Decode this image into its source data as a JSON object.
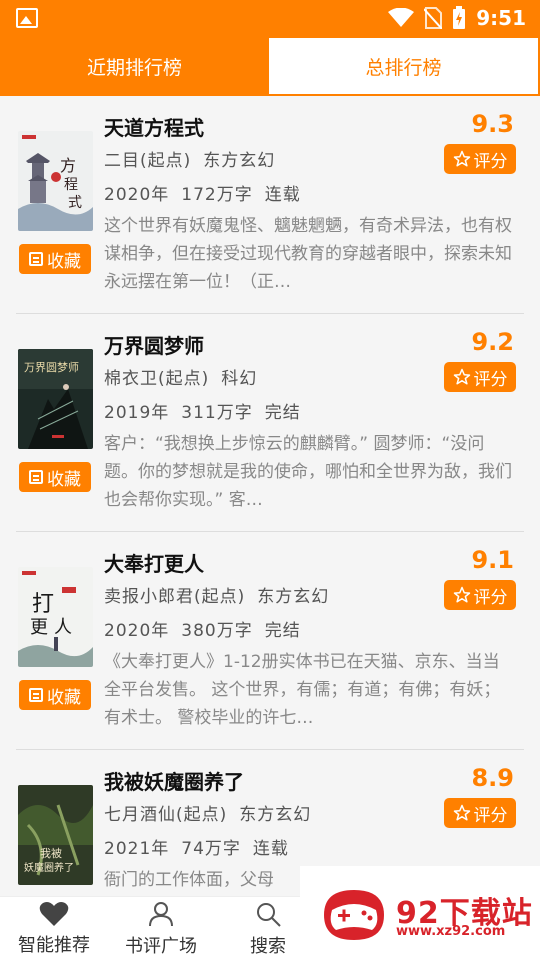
{
  "status": {
    "time": "9:51"
  },
  "tabs": [
    {
      "label": "近期排行榜",
      "active": true
    },
    {
      "label": "总排行榜",
      "active": false
    }
  ],
  "books": [
    {
      "title": "天道方程式",
      "score": "9.3",
      "rate_label": "评分",
      "fav_label": "收藏",
      "author": "二目(起点)",
      "genre": "东方玄幻",
      "year": "2020年",
      "words": "172万字",
      "state": "连载",
      "desc": "这个世界有妖魔鬼怪、魑魅魍魉，有奇术异法，也有权谋相争，但在接受过现代教育的穿越者眼中，探索未知永远摆在第一位！（正…"
    },
    {
      "title": "万界圆梦师",
      "score": "9.2",
      "rate_label": "评分",
      "fav_label": "收藏",
      "author": "棉衣卫(起点)",
      "genre": "科幻",
      "year": "2019年",
      "words": "311万字",
      "state": "完结",
      "desc": "客户：“我想换上步惊云的麒麟臂。” 圆梦师：“没问题。你的梦想就是我的使命，哪怕和全世界为敌，我们也会帮你实现。” 客…"
    },
    {
      "title": "大奉打更人",
      "score": "9.1",
      "rate_label": "评分",
      "fav_label": "收藏",
      "author": "卖报小郎君(起点)",
      "genre": "东方玄幻",
      "year": "2020年",
      "words": "380万字",
      "state": "完结",
      "desc": "《大奉打更人》1-12册实体书已在天猫、京东、当当全平台发售。 这个世界，有儒；有道；有佛；有妖；有术士。 警校毕业的许七…"
    },
    {
      "title": "我被妖魔圈养了",
      "score": "8.9",
      "rate_label": "评分",
      "fav_label": "收藏",
      "author": "七月酒仙(起点)",
      "genre": "东方玄幻",
      "year": "2021年",
      "words": "74万字",
      "state": "连载",
      "desc": "衙门的工作体面，父母"
    }
  ],
  "bottom_nav": [
    {
      "label": "智能推荐",
      "icon": "heart-icon"
    },
    {
      "label": "书评广场",
      "icon": "user-icon"
    },
    {
      "label": "搜索",
      "icon": "search-icon"
    }
  ],
  "watermark": {
    "brand": "92下载站",
    "url": "www.xz92.com"
  },
  "colors": {
    "accent": "#ff8000",
    "brand_red": "#d8232a"
  }
}
